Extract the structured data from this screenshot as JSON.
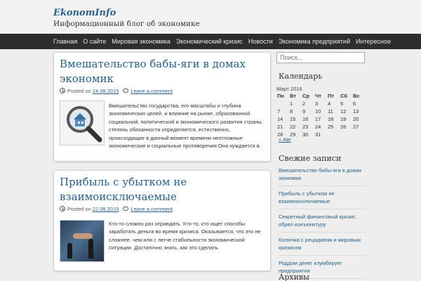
{
  "header": {
    "site_title": "EkonomInfo",
    "site_description": "Информационный блог об экономике"
  },
  "nav": {
    "items": [
      {
        "label": "Главная"
      },
      {
        "label": "О сайте"
      },
      {
        "label": "Мировая экономика"
      },
      {
        "label": "Экономический кризис"
      },
      {
        "label": "Новости"
      },
      {
        "label": "Экономика предприятий"
      },
      {
        "label": "Интересное"
      }
    ]
  },
  "posts": [
    {
      "title": "Вмешательство бабы-яги в домах экономик",
      "posted_on_label": "Posted on",
      "date": "24.08.2015",
      "comment_label": "Leave a comment",
      "excerpt": "Вмешательство государства, его масштабы и глубина экономических целей, и влияние на рынке, образованной социальной, политической и экономического развития страны, степень обязанности определяется, естественно, происходящие в данный момент времени неотложные экономические и социальные противоречия Она нуждается в."
    },
    {
      "title": "Прибыль с убытком не взаимоисключаемые",
      "posted_on_label": "Posted on",
      "date": "22.08.2015",
      "comment_label": "Leave a comment",
      "excerpt": "Кто-то сложно раз оправдать. Кто-то, кто ищет способы заработать деньги во время кризиса. Оказывается, что это не сложнее, чем или с легче стабильности экономической ситуации. Достаточно знать, как это сделать."
    }
  ],
  "sidebar": {
    "search_placeholder": "Поиск...",
    "calendar_title": "Календарь",
    "calendar": {
      "caption": "Март 2016",
      "weekdays": [
        "Пн",
        "Вт",
        "Ср",
        "Чт",
        "Пт",
        "Сб",
        "Вс"
      ],
      "weeks": [
        [
          "",
          "1",
          "2",
          "3",
          "4",
          "5",
          "6"
        ],
        [
          "7",
          "8",
          "9",
          "10",
          "11",
          "12",
          "13"
        ],
        [
          "14",
          "15",
          "16",
          "17",
          "18",
          "19",
          "20"
        ],
        [
          "21",
          "22",
          "23",
          "24",
          "25",
          "26",
          "27"
        ],
        [
          "28",
          "29",
          "30",
          "31",
          "",
          "",
          ""
        ]
      ],
      "prev_link": "« Авг"
    },
    "recent_title": "Свежие записи",
    "recent_posts": [
      {
        "label": "Вмешательство бабы-яги в домах экономик"
      },
      {
        "label": "Прибыль с убытком не взаимоисключаемые"
      },
      {
        "label": "Секретный финансовый кризис обрел конъюнктуру"
      },
      {
        "label": "Колючка с рецидивом и мировым кризисом"
      },
      {
        "label": "Роддом денег клумбирует предприятия"
      }
    ],
    "archive_title": "Архивы"
  },
  "colors": {
    "link": "#2a5f87",
    "nav_background": "#2b2b2b",
    "page_background": "#eeeeee"
  }
}
